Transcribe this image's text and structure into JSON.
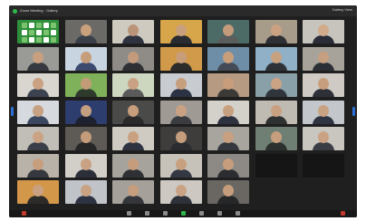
{
  "window": {
    "title_left": "Zoom Meeting  ·  Gallery",
    "title_right": "Gallery View",
    "recording_color": "#2fb84a"
  },
  "gallery": {
    "rows": [
      [
        {
          "kind": "logo",
          "wall": "#2f8f3a",
          "skin": "#ffffff",
          "shirt": "#ffffff"
        },
        {
          "kind": "person",
          "wall": "#6b6a66",
          "skin": "#c9a17c",
          "shirt": "#3a3f4a"
        },
        {
          "kind": "person",
          "wall": "#cfcac0",
          "skin": "#b99478",
          "shirt": "#2f3340"
        },
        {
          "kind": "person",
          "wall": "#d8a64a",
          "skin": "#c9a07c",
          "shirt": "#2a2b30"
        },
        {
          "kind": "person",
          "wall": "#4d6b66",
          "skin": "#c39a7a",
          "shirt": "#5a5e5c"
        },
        {
          "kind": "person",
          "wall": "#a79b8a",
          "skin": "#caa283",
          "shirt": "#2f3035"
        },
        {
          "kind": "person",
          "wall": "#c7c4bd",
          "skin": "#d1ab8a",
          "shirt": "#2a2d38"
        }
      ],
      [
        {
          "kind": "person",
          "wall": "#9a9a96",
          "skin": "#c9a07f",
          "shirt": "#36393f"
        },
        {
          "kind": "person",
          "wall": "#c8d4df",
          "skin": "#c69d7b",
          "shirt": "#3b4a6e"
        },
        {
          "kind": "person",
          "wall": "#8f8b86",
          "skin": "#c39b7c",
          "shirt": "#2e3034"
        },
        {
          "kind": "person",
          "wall": "#d19a4b",
          "skin": "#c79d7a",
          "shirt": "#2d2c2a"
        },
        {
          "kind": "person",
          "wall": "#6e8ea8",
          "skin": "#c99e7b",
          "shirt": "#444b56"
        },
        {
          "kind": "person",
          "wall": "#8fb0c7",
          "skin": "#c8a181",
          "shirt": "#2f3338"
        },
        {
          "kind": "person",
          "wall": "#a8a39a",
          "skin": "#c59f7f",
          "shirt": "#2c2f36"
        }
      ],
      [
        {
          "kind": "person",
          "wall": "#d9d6d0",
          "skin": "#caa283",
          "shirt": "#3d4250"
        },
        {
          "kind": "person",
          "wall": "#7fb15a",
          "skin": "#c49b78",
          "shirt": "#2e3a2c"
        },
        {
          "kind": "person",
          "wall": "#cdd7bf",
          "skin": "#c9a283",
          "shirt": "#5a5a5a"
        },
        {
          "kind": "person",
          "wall": "#c8cbd0",
          "skin": "#c69f7e",
          "shirt": "#2b3244"
        },
        {
          "kind": "person",
          "wall": "#b69b82",
          "skin": "#c79d7b",
          "shirt": "#3c3a36"
        },
        {
          "kind": "person",
          "wall": "#8aa0a8",
          "skin": "#caa385",
          "shirt": "#30353c"
        },
        {
          "kind": "person",
          "wall": "#cfcbc4",
          "skin": "#c89f7e",
          "shirt": "#2e3038"
        }
      ],
      [
        {
          "kind": "person",
          "wall": "#d6d9dd",
          "skin": "#c7a182",
          "shirt": "#3c4860"
        },
        {
          "kind": "person",
          "wall": "#2d3d6e",
          "skin": "#c49e80",
          "shirt": "#1d2130"
        },
        {
          "kind": "person",
          "wall": "#4a4a48",
          "skin": "#c79e7c",
          "shirt": "#2a2a2a"
        },
        {
          "kind": "person",
          "wall": "#9f9a93",
          "skin": "#caa283",
          "shirt": "#3a3c40"
        },
        {
          "kind": "person",
          "wall": "#d4d0ca",
          "skin": "#c7a080",
          "shirt": "#2d3140"
        },
        {
          "kind": "person",
          "wall": "#bfbab2",
          "skin": "#c9a181",
          "shirt": "#2f3030"
        },
        {
          "kind": "person",
          "wall": "#c3c6ca",
          "skin": "#c8a282",
          "shirt": "#2e3442"
        }
      ],
      [
        {
          "kind": "person",
          "wall": "#c1bdb7",
          "skin": "#caa385",
          "shirt": "#3a3e48"
        },
        {
          "kind": "person",
          "wall": "#5e5a55",
          "skin": "#c59c7a",
          "shirt": "#262626"
        },
        {
          "kind": "person",
          "wall": "#cfcbc3",
          "skin": "#c9a181",
          "shirt": "#2f3240"
        },
        {
          "kind": "person",
          "wall": "#3e3d3b",
          "skin": "#c49d7d",
          "shirt": "#2a2c30"
        },
        {
          "kind": "person",
          "wall": "#a8a49e",
          "skin": "#c8a081",
          "shirt": "#34373d"
        },
        {
          "kind": "person",
          "wall": "#6f7f73",
          "skin": "#c79f7f",
          "shirt": "#2c302e"
        },
        {
          "kind": "person",
          "wall": "#c9c5bf",
          "skin": "#caa283",
          "shirt": "#3a3d44"
        }
      ],
      [
        {
          "kind": "person",
          "wall": "#b8b2a8",
          "skin": "#c79f7e",
          "shirt": "#35383e"
        },
        {
          "kind": "person",
          "wall": "#d2cec8",
          "skin": "#c9a283",
          "shirt": "#2c2f3a"
        },
        {
          "kind": "person",
          "wall": "#a6a29c",
          "skin": "#c59d7c",
          "shirt": "#2e3033"
        },
        {
          "kind": "person",
          "wall": "#c6c2ba",
          "skin": "#c7a080",
          "shirt": "#343843"
        },
        {
          "kind": "person",
          "wall": "#8d8a85",
          "skin": "#c69e7d",
          "shirt": "#2b2d31"
        },
        {
          "kind": "dark",
          "wall": "#151515",
          "skin": "",
          "shirt": ""
        },
        {
          "kind": "dark",
          "wall": "#151515",
          "skin": "",
          "shirt": ""
        }
      ],
      [
        {
          "kind": "person",
          "wall": "#d3974a",
          "skin": "#c9a181",
          "shirt": "#2c2b29"
        },
        {
          "kind": "person",
          "wall": "#c0c3c8",
          "skin": "#c8a282",
          "shirt": "#2d3342"
        },
        {
          "kind": "person",
          "wall": "#a5a09a",
          "skin": "#c69e7e",
          "shirt": "#34363b"
        },
        {
          "kind": "person",
          "wall": "#cdc9c2",
          "skin": "#c9a384",
          "shirt": "#2e3139"
        },
        {
          "kind": "person",
          "wall": "#6a6762",
          "skin": "#c59d7c",
          "shirt": "#262728"
        },
        {
          "kind": "empty",
          "wall": "#1f1f1f",
          "skin": "",
          "shirt": ""
        },
        {
          "kind": "empty",
          "wall": "#1f1f1f",
          "skin": "",
          "shirt": ""
        }
      ]
    ]
  },
  "toolbar": {
    "icons": [
      {
        "name": "mute-icon",
        "color": "#c0392b"
      },
      {
        "name": "video-icon",
        "color": "#8a8a8a"
      },
      {
        "name": "security-icon",
        "color": "#8a8a8a"
      },
      {
        "name": "participants-icon",
        "color": "#8a8a8a"
      },
      {
        "name": "chat-icon",
        "color": "#2fb84a"
      },
      {
        "name": "share-screen-icon",
        "color": "#8a8a8a"
      },
      {
        "name": "record-icon",
        "color": "#8a8a8a"
      },
      {
        "name": "reactions-icon",
        "color": "#8a8a8a"
      },
      {
        "name": "leave-icon",
        "color": "#c0392b"
      }
    ]
  },
  "accent": {
    "side_arrow": "#2b6fd6"
  }
}
